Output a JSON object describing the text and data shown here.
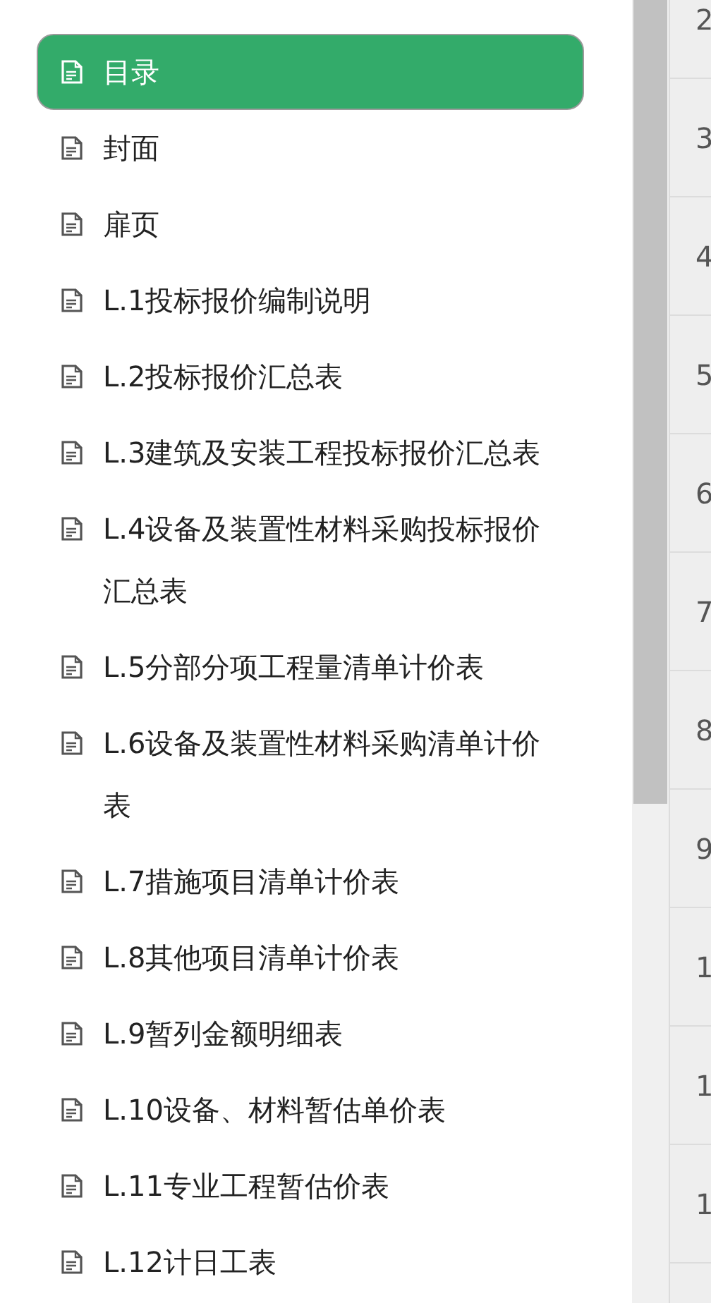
{
  "outline": [
    {
      "label": "目录",
      "selected": true
    },
    {
      "label": "封面",
      "selected": false
    },
    {
      "label": "扉页",
      "selected": false
    },
    {
      "label": "L.1投标报价编制说明",
      "selected": false
    },
    {
      "label": "L.2投标报价汇总表",
      "selected": false
    },
    {
      "label": "L.3建筑及安装工程投标报价汇总表",
      "selected": false
    },
    {
      "label": "L.4设备及装置性材料采购投标报价汇总表",
      "selected": false
    },
    {
      "label": "L.5分部分项工程量清单计价表",
      "selected": false
    },
    {
      "label": "L.6设备及装置性材料采购清单计价表",
      "selected": false
    },
    {
      "label": "L.7措施项目清单计价表",
      "selected": false
    },
    {
      "label": "L.8其他项目清单计价表",
      "selected": false
    },
    {
      "label": "L.9暂列金额明细表",
      "selected": false
    },
    {
      "label": "L.10设备、材料暂估单价表",
      "selected": false
    },
    {
      "label": "L.11专业工程暂估价表",
      "selected": false
    },
    {
      "label": "L.12计日工表",
      "selected": false
    }
  ],
  "row_numbers": [
    "2",
    "3",
    "4",
    "5",
    "6",
    "7",
    "8",
    "9",
    "1",
    "1",
    "1"
  ]
}
